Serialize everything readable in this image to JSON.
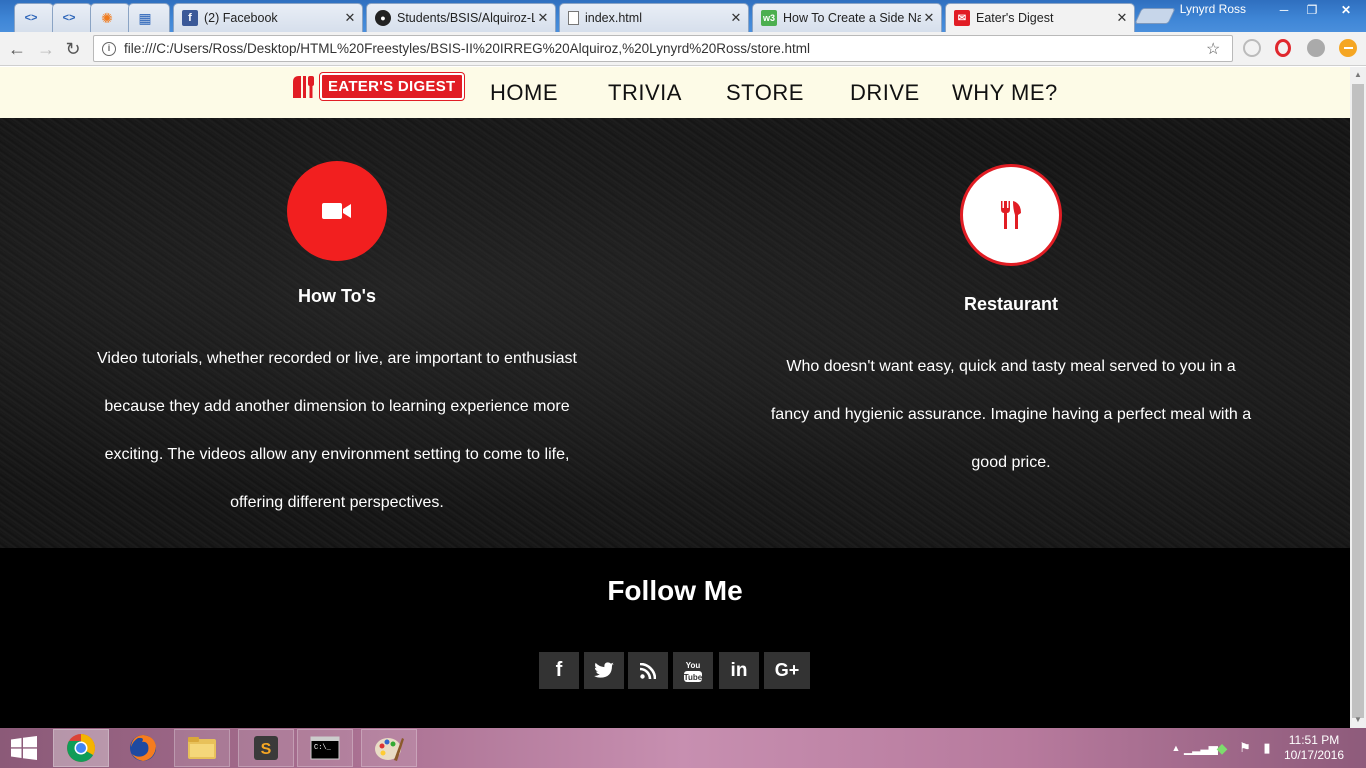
{
  "browser": {
    "tabs": [
      {
        "title": "",
        "icon": "code-icon",
        "active": false
      },
      {
        "title": "",
        "icon": "code-icon",
        "active": false
      },
      {
        "title": "",
        "icon": "avast-icon",
        "active": false
      },
      {
        "title": "",
        "icon": "grid-icon",
        "active": false
      },
      {
        "title": "(2) Facebook",
        "icon": "facebook-icon",
        "active": false
      },
      {
        "title": "Students/BSIS/Alquiroz-L",
        "icon": "github-icon",
        "active": false
      },
      {
        "title": "index.html",
        "icon": "file-icon",
        "active": false
      },
      {
        "title": "How To Create a Side Na",
        "icon": "w3-icon",
        "active": false
      },
      {
        "title": "Eater's Digest",
        "icon": "eaters-digest-icon",
        "active": true
      }
    ],
    "profile_name": "Lynyrd Ross",
    "url": "file:///C:/Users/Ross/Desktop/HTML%20Freestyles/BSIS-II%20IRREG%20Alquiroz,%20Lynyrd%20Ross/store.html"
  },
  "site": {
    "logo_text": "EATER'S DIGEST",
    "nav": [
      "HOME",
      "TRIVIA",
      "STORE",
      "DRIVE",
      "WHY ME?"
    ],
    "features": [
      {
        "icon": "video-camera-icon",
        "title": "How To's",
        "lines": [
          "Video tutorials, whether recorded or live, are important to enthusiast",
          "because they add another dimension to learning experience more",
          "exciting. The videos allow any environment setting to come to life,",
          "offering different perspectives."
        ]
      },
      {
        "icon": "fork-knife-icon",
        "title": "Restaurant",
        "lines": [
          "Who doesn't want easy, quick and tasty meal served to you in a",
          "fancy and hygienic assurance. Imagine having a perfect meal with a",
          "good price."
        ]
      }
    ],
    "follow_title": "Follow Me",
    "social": [
      {
        "name": "facebook-icon",
        "glyph": "f"
      },
      {
        "name": "twitter-icon",
        "glyph": ""
      },
      {
        "name": "rss-icon",
        "glyph": ""
      },
      {
        "name": "youtube-icon",
        "glyph": "You Tube"
      },
      {
        "name": "linkedin-icon",
        "glyph": "in"
      },
      {
        "name": "google-plus-icon",
        "glyph": "G+"
      }
    ]
  },
  "taskbar": {
    "time": "11:51 PM",
    "date": "10/17/2016"
  },
  "colors": {
    "accent_red": "#e11d24",
    "nav_bg": "#fdfbe7",
    "page_bg": "#000000"
  }
}
